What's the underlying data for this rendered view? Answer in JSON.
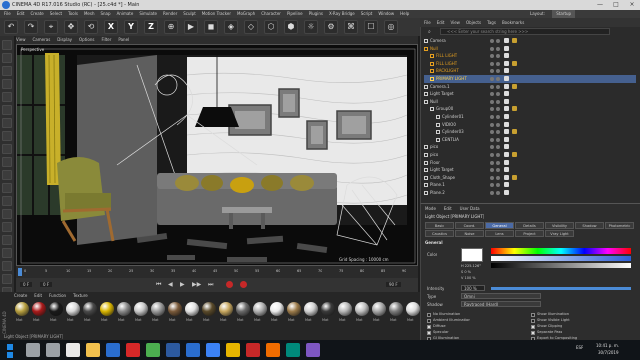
{
  "window": {
    "title": "CINEMA 4D R17.016 Studio (RC) - [25.c4d *] - Main",
    "buttons": [
      "—",
      "□",
      "×"
    ]
  },
  "menubar": {
    "items": [
      "File",
      "Edit",
      "Create",
      "Select",
      "Tools",
      "Mesh",
      "Snap",
      "Animate",
      "Simulate",
      "Render",
      "Sculpt",
      "Motion Tracker",
      "MoGraph",
      "Character",
      "Pipeline",
      "Plugins",
      "X-Ray Bridge",
      "Script",
      "Window",
      "Help"
    ],
    "layout_label": "Layout:",
    "layout_value": "Startup"
  },
  "toolbar": {
    "buttons": [
      "↶",
      "↷",
      "⌖",
      "✥",
      "⟲",
      "X",
      "Y",
      "Z",
      "⊕",
      "▶",
      "◼",
      "◈",
      "◇",
      "⬡",
      "⬢",
      "☼",
      "⚙",
      "⌘",
      "☐",
      "◎"
    ]
  },
  "viewport": {
    "menu": [
      "View",
      "Cameras",
      "Display",
      "Options",
      "Filter",
      "Panel"
    ],
    "label": "Perspective",
    "grid_spacing": "Grid Spacing : 10000 cm"
  },
  "timeline": {
    "ticks": [
      "0",
      "5",
      "10",
      "15",
      "20",
      "25",
      "30",
      "35",
      "40",
      "45",
      "50",
      "55",
      "60",
      "65",
      "70",
      "75",
      "80",
      "85",
      "90"
    ],
    "frame_start": "0 F",
    "frame_end": "90 F",
    "current": "0 F"
  },
  "materials": {
    "menu": [
      "Create",
      "Edit",
      "Function",
      "Texture"
    ],
    "side_label": "CINEMA 4D",
    "items": [
      {
        "label": "Mat",
        "color": "#b8a040"
      },
      {
        "label": "Mat",
        "color": "#aa1a1a"
      },
      {
        "label": "Mat",
        "color": "#1a1a1a"
      },
      {
        "label": "Mat",
        "color": "#d8d8d8"
      },
      {
        "label": "Mat",
        "color": "#4a4a4a"
      },
      {
        "label": "Mat",
        "color": "#d8b400"
      },
      {
        "label": "Mat",
        "color": "#8a8a8a"
      },
      {
        "label": "Mat",
        "color": "#c8c8c8"
      },
      {
        "label": "Mat",
        "color": "#9a9a9a"
      },
      {
        "label": "Mat",
        "color": "#7a5a3a"
      },
      {
        "label": "Mat",
        "color": "#e0e0e0"
      },
      {
        "label": "Mat",
        "color": "#5a4a2a"
      },
      {
        "label": "Mat",
        "color": "#c8a860"
      },
      {
        "label": "Mat",
        "color": "#6a6a6a"
      },
      {
        "label": "Mat",
        "color": "#b0b0b0"
      },
      {
        "label": "Mat",
        "color": "#eaeaea"
      },
      {
        "label": "Mat",
        "color": "#9c7b4a"
      },
      {
        "label": "Mat",
        "color": "#d0d0d0"
      },
      {
        "label": "Mat",
        "color": "#3a3a3a"
      },
      {
        "label": "Mat",
        "color": "#b8b8b8"
      },
      {
        "label": "Mat",
        "color": "#c0c0c0"
      },
      {
        "label": "Mat",
        "color": "#a8a8a8"
      },
      {
        "label": "Mat",
        "color": "#7c7c7c"
      },
      {
        "label": "Mat",
        "color": "#dcdcdc"
      }
    ],
    "status": "Light Object [PRIMARY LIGHT]"
  },
  "objects": {
    "menu": [
      "File",
      "Edit",
      "View",
      "Objects",
      "Tags",
      "Bookmarks"
    ],
    "search_placeholder": "<<< Enter your search string here >>>",
    "rows": [
      {
        "name": "Camera",
        "indent": 0,
        "color": "#d0d0d0"
      },
      {
        "name": "Null",
        "indent": 0,
        "color": "#e6a020"
      },
      {
        "name": "FILL LIGHT",
        "indent": 1,
        "color": "#e6a020"
      },
      {
        "name": "FILL LIGHT",
        "indent": 1,
        "color": "#e6a020"
      },
      {
        "name": "BACKLIGHT",
        "indent": 1,
        "color": "#e6a020"
      },
      {
        "name": "PRIMARY LIGHT",
        "indent": 1,
        "color": "#ffd24a",
        "selected": true
      },
      {
        "name": "Camera.1",
        "indent": 0,
        "color": "#d0d0d0"
      },
      {
        "name": "Light Target",
        "indent": 0,
        "color": "#d0d0d0"
      },
      {
        "name": "Null",
        "indent": 0,
        "color": "#d0d0d0"
      },
      {
        "name": "Group00",
        "indent": 1,
        "color": "#d0d0d0"
      },
      {
        "name": "Cylinder01",
        "indent": 2,
        "color": "#d0d0d0"
      },
      {
        "name": "VIDIO0",
        "indent": 2,
        "color": "#d0d0d0"
      },
      {
        "name": "Cylinder03",
        "indent": 2,
        "color": "#d0d0d0"
      },
      {
        "name": "CENTLIA",
        "indent": 2,
        "color": "#d0d0d0"
      },
      {
        "name": "pico",
        "indent": 0,
        "color": "#d0d0d0"
      },
      {
        "name": "pico",
        "indent": 0,
        "color": "#d0d0d0"
      },
      {
        "name": "Floor",
        "indent": 0,
        "color": "#d0d0d0"
      },
      {
        "name": "Light Target",
        "indent": 0,
        "color": "#d0d0d0"
      },
      {
        "name": "Cloth_Shape",
        "indent": 0,
        "color": "#d0d0d0"
      },
      {
        "name": "Plane.1",
        "indent": 0,
        "color": "#d0d0d0"
      },
      {
        "name": "Plane.2",
        "indent": 0,
        "color": "#d0d0d0"
      }
    ]
  },
  "attributes": {
    "menu": [
      "Mode",
      "Edit",
      "User Data"
    ],
    "object_label": "Light Object [PRIMARY LIGHT]",
    "tabs_row1": [
      "Basic",
      "Coord.",
      "General",
      "Details",
      "Visibility",
      "Shadow",
      "Photometric"
    ],
    "tabs_row2": [
      "Caustics",
      "Noise",
      "Lens",
      "Project",
      "Vray Light"
    ],
    "active_tab": "General",
    "section": "General",
    "color_label": "Color",
    "color_values": [
      "H  225.126°",
      "S  0 %",
      "V  100 %"
    ],
    "intensity_label": "Intensity",
    "intensity_value": "100 %",
    "type_label": "Type",
    "type_value": "Omni",
    "shadow_label": "Shadow",
    "shadow_value": "Raytraced (Hard)",
    "checks_left": [
      "No Illumination",
      "Ambient Illumination",
      "Diffuse",
      "Specular",
      "GI Illumination"
    ],
    "checks_right": [
      "Show Illumination",
      "Show Visible Light",
      "Show Clipping",
      "Separate Pass",
      "Export to Compositing"
    ]
  },
  "taskbar": {
    "clock_time": "10:41 p. m.",
    "clock_date": "30/7/2019",
    "lang": "ESP",
    "icons": [
      {
        "name": "start",
        "color": "#1e88e5"
      },
      {
        "name": "search",
        "color": "#9aa0a6"
      },
      {
        "name": "task-view",
        "color": "#9aa0a6"
      },
      {
        "name": "browser",
        "color": "#e8e8e8"
      },
      {
        "name": "folder",
        "color": "#f2c14e"
      },
      {
        "name": "store",
        "color": "#2a6ecf"
      },
      {
        "name": "red-app",
        "color": "#d62828"
      },
      {
        "name": "chrome",
        "color": "#4caf50"
      },
      {
        "name": "photoshop",
        "color": "#2c5aa0"
      },
      {
        "name": "cinema4d",
        "color": "#2a6ecf"
      },
      {
        "name": "app-blue",
        "color": "#3b82f6"
      },
      {
        "name": "app-yellow",
        "color": "#e6b400"
      },
      {
        "name": "app-red",
        "color": "#c62828"
      },
      {
        "name": "app-orange",
        "color": "#ef6c00"
      },
      {
        "name": "app-teal",
        "color": "#00897b"
      },
      {
        "name": "app-purple",
        "color": "#7e57c2"
      }
    ]
  }
}
